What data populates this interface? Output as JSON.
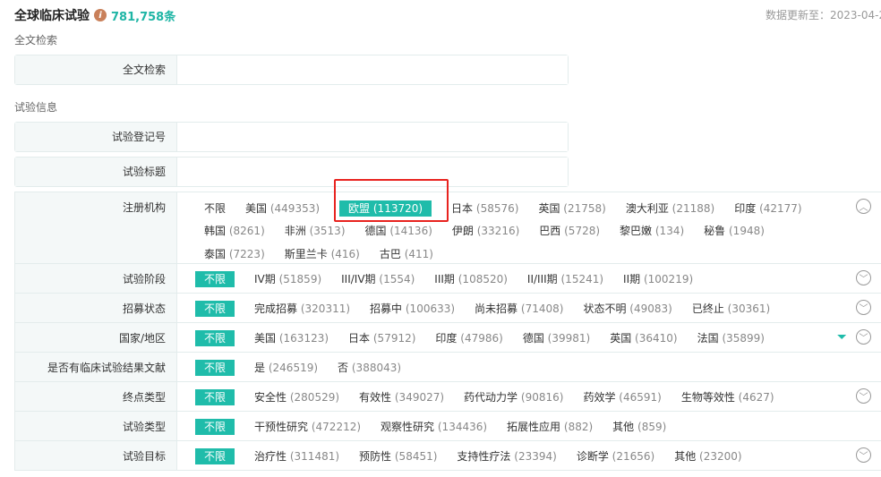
{
  "header": {
    "title": "全球临床试验",
    "count": "781,758条",
    "updated": "数据更新至：2023-04-2"
  },
  "sections": {
    "fulltext": "全文检索",
    "trial_info": "试验信息"
  },
  "fields": {
    "fulltext_label": "全文检索",
    "reg_no_label": "试验登记号",
    "title_label": "试验标题"
  },
  "filters": [
    {
      "label": "注册机构",
      "any": "不限",
      "options": [
        [
          "美国",
          "(449353)"
        ],
        [
          "欧盟",
          "(113720)"
        ],
        [
          "日本",
          "(58576)"
        ],
        [
          "英国",
          "(21758)"
        ],
        [
          "澳大利亚",
          "(21188)"
        ],
        [
          "印度",
          "(42177)"
        ],
        [
          "韩国",
          "(8261)"
        ],
        [
          "非洲",
          "(3513)"
        ],
        [
          "德国",
          "(14136)"
        ],
        [
          "伊朗",
          "(33216)"
        ],
        [
          "巴西",
          "(5728)"
        ],
        [
          "黎巴嫩",
          "(134)"
        ],
        [
          "秘鲁",
          "(1948)"
        ],
        [
          "泰国",
          "(7223)"
        ],
        [
          "斯里兰卡",
          "(416)"
        ],
        [
          "古巴",
          "(411)"
        ]
      ],
      "selected": 1
    },
    {
      "label": "试验阶段",
      "any": "不限",
      "options": [
        [
          "IV期",
          "(51859)"
        ],
        [
          "III/IV期",
          "(1554)"
        ],
        [
          "III期",
          "(108520)"
        ],
        [
          "II/III期",
          "(15241)"
        ],
        [
          "II期",
          "(100219)"
        ]
      ]
    },
    {
      "label": "招募状态",
      "any": "不限",
      "options": [
        [
          "完成招募",
          "(320311)"
        ],
        [
          "招募中",
          "(100633)"
        ],
        [
          "尚未招募",
          "(71408)"
        ],
        [
          "状态不明",
          "(49083)"
        ],
        [
          "已终止",
          "(30361)"
        ]
      ]
    },
    {
      "label": "国家/地区",
      "any": "不限",
      "options": [
        [
          "美国",
          "(163123)"
        ],
        [
          "日本",
          "(57912)"
        ],
        [
          "印度",
          "(47986)"
        ],
        [
          "德国",
          "(39981)"
        ],
        [
          "英国",
          "(36410)"
        ],
        [
          "法国",
          "(35899)"
        ]
      ],
      "filter": true
    },
    {
      "label": "是否有临床试验结果文献",
      "any": "不限",
      "options": [
        [
          "是",
          "(246519)"
        ],
        [
          "否",
          "(388043)"
        ]
      ],
      "nochev": true
    },
    {
      "label": "终点类型",
      "any": "不限",
      "options": [
        [
          "安全性",
          "(280529)"
        ],
        [
          "有效性",
          "(349027)"
        ],
        [
          "药代动力学",
          "(90816)"
        ],
        [
          "药效学",
          "(46591)"
        ],
        [
          "生物等效性",
          "(4627)"
        ]
      ]
    },
    {
      "label": "试验类型",
      "any": "不限",
      "options": [
        [
          "干预性研究",
          "(472212)"
        ],
        [
          "观察性研究",
          "(134436)"
        ],
        [
          "拓展性应用",
          "(882)"
        ],
        [
          "其他",
          "(859)"
        ]
      ],
      "nochev": true
    },
    {
      "label": "试验目标",
      "any": "不限",
      "options": [
        [
          "治疗性",
          "(311481)"
        ],
        [
          "预防性",
          "(58451)"
        ],
        [
          "支持性疗法",
          "(23394)"
        ],
        [
          "诊断学",
          "(21656)"
        ],
        [
          "其他",
          "(23200)"
        ]
      ]
    }
  ]
}
